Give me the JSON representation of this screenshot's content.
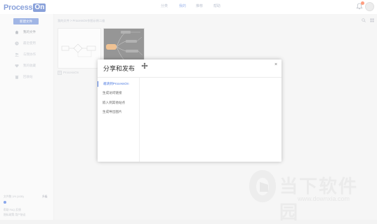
{
  "app": {
    "logo_text": "Process",
    "logo_on": "On"
  },
  "topnav": [
    {
      "label": "分类"
    },
    {
      "label": "我的"
    },
    {
      "label": "推荐"
    },
    {
      "label": "帮助"
    }
  ],
  "sidebar": {
    "new_button": "新建文件",
    "items": [
      {
        "label": "我的文件",
        "icon": "home-icon"
      },
      {
        "label": "最近使用",
        "icon": "clock-icon"
      },
      {
        "label": "与我协作",
        "icon": "users-icon"
      },
      {
        "label": "我的收藏",
        "icon": "heart-icon"
      },
      {
        "label": "回收站",
        "icon": "trash-icon"
      }
    ],
    "storage": "文件数 2/9 (1GB)",
    "upgrade": "升级",
    "foot1": "帮助 FAQ   反馈",
    "foot2": "隐私政策   用户协议"
  },
  "main": {
    "breadcrumb": "我的文件  >  ProcessOn作图示例二维",
    "card_label": "ProcessOn"
  },
  "modal": {
    "title": "分享和发布",
    "close": "×",
    "menu": [
      {
        "label": "邀请到ProcessOn",
        "active": true
      },
      {
        "label": "生成访问链接",
        "active": false
      },
      {
        "label": "嵌入到其他站点",
        "active": false
      },
      {
        "label": "生成导出图片",
        "active": false
      }
    ]
  },
  "watermark": {
    "cn": "当下软件园",
    "url": "www.downxia.com"
  },
  "colors": {
    "accent": "#4a78e0",
    "button": "#6f8fd8",
    "badge": "#ff6b3d"
  }
}
